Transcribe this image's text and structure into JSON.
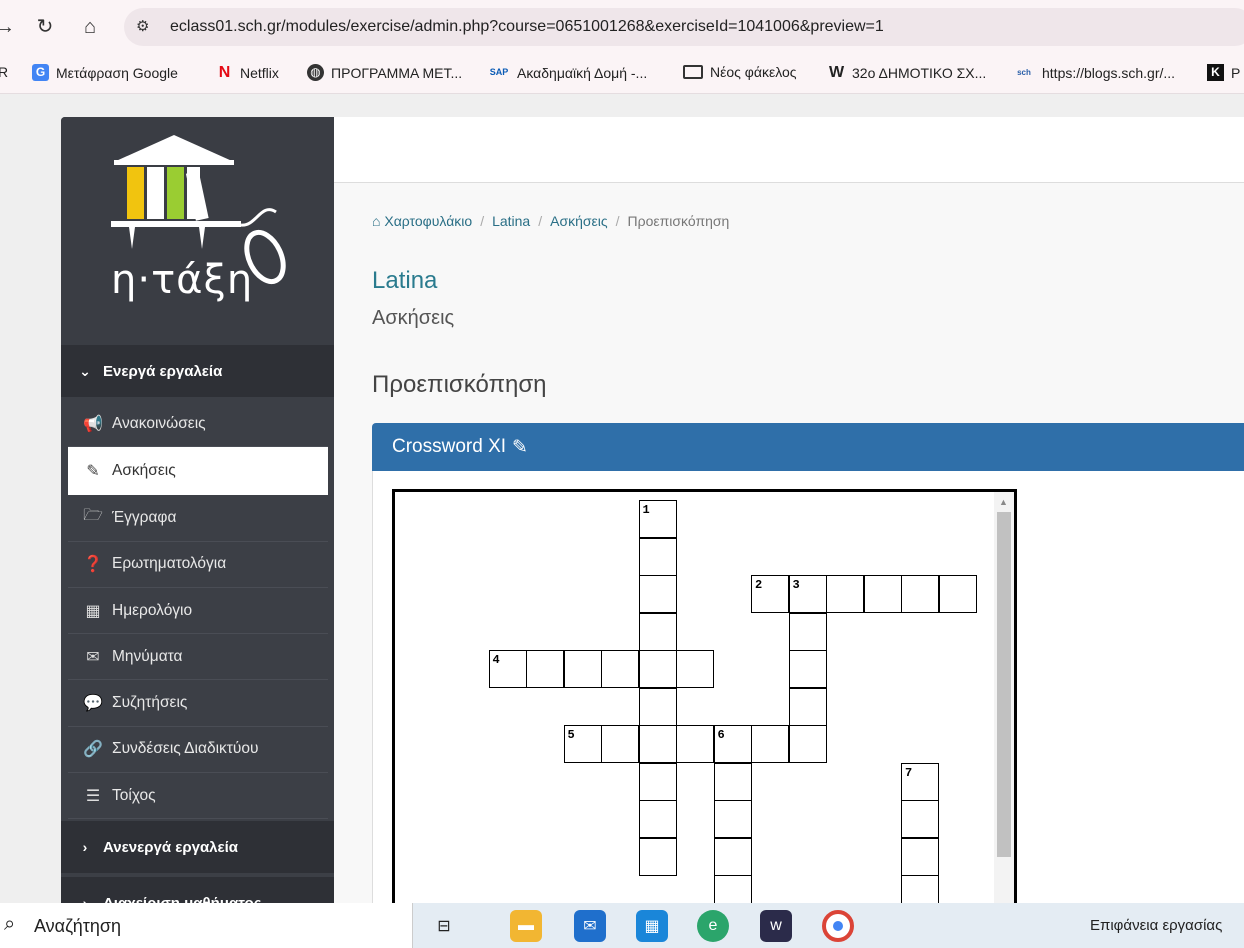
{
  "browser": {
    "url": "eclass01.sch.gr/modules/exercise/admin.php?course=0651001268&exerciseId=1041006&preview=1",
    "bookmarks": [
      {
        "label": "R",
        "icon": ""
      },
      {
        "label": "Μετάφραση Google",
        "icon": "google-translate-icon"
      },
      {
        "label": "Netflix",
        "icon": "netflix-icon"
      },
      {
        "label": "ΠΡΟΓΡΑΜΜΑ ΜΕΤ...",
        "icon": "globe-icon"
      },
      {
        "label": "Ακαδημαϊκή Δομή -...",
        "icon": "sap-icon"
      },
      {
        "label": "Νέος φάκελος",
        "icon": "folder-icon"
      },
      {
        "label": "32ο ΔΗΜΟΤΙΚΟ ΣΧ...",
        "icon": "w-icon"
      },
      {
        "label": "https://blogs.sch.gr/...",
        "icon": "sch-icon"
      },
      {
        "label": "P",
        "icon": "k-icon"
      }
    ]
  },
  "sidebar": {
    "logo_text": "η·τάξη",
    "active_section": "Ενεργά εργαλεία",
    "inactive_section": "Ανενεργά εργαλεία",
    "admin_section": "Διαχείριση μαθήματος",
    "items": [
      {
        "label": "Ανακοινώσεις",
        "icon": "megaphone-icon"
      },
      {
        "label": "Ασκήσεις",
        "icon": "edit-icon"
      },
      {
        "label": "Έγγραφα",
        "icon": "folder-open-icon"
      },
      {
        "label": "Ερωτηματολόγια",
        "icon": "question-icon"
      },
      {
        "label": "Ημερολόγιο",
        "icon": "calendar-icon"
      },
      {
        "label": "Μηνύματα",
        "icon": "envelope-icon"
      },
      {
        "label": "Συζητήσεις",
        "icon": "comments-icon"
      },
      {
        "label": "Συνδέσεις Διαδικτύου",
        "icon": "link-icon"
      },
      {
        "label": "Τοίχος",
        "icon": "list-icon"
      }
    ]
  },
  "breadcrumb": [
    "Χαρτοφυλάκιο",
    "Latina",
    "Ασκήσεις",
    "Προεπισκόπηση"
  ],
  "course": {
    "title": "Latina",
    "subtitle": "Ασκήσεις"
  },
  "page_heading": "Προεπισκόπηση",
  "panel_title": "Crossword XI",
  "crossword": {
    "clue_numbers": [
      "1",
      "2",
      "3",
      "4",
      "5",
      "6",
      "7"
    ]
  },
  "taskbar": {
    "search_placeholder": "Αναζήτηση",
    "desktop_label": "Επιφάνεια εργασίας"
  }
}
